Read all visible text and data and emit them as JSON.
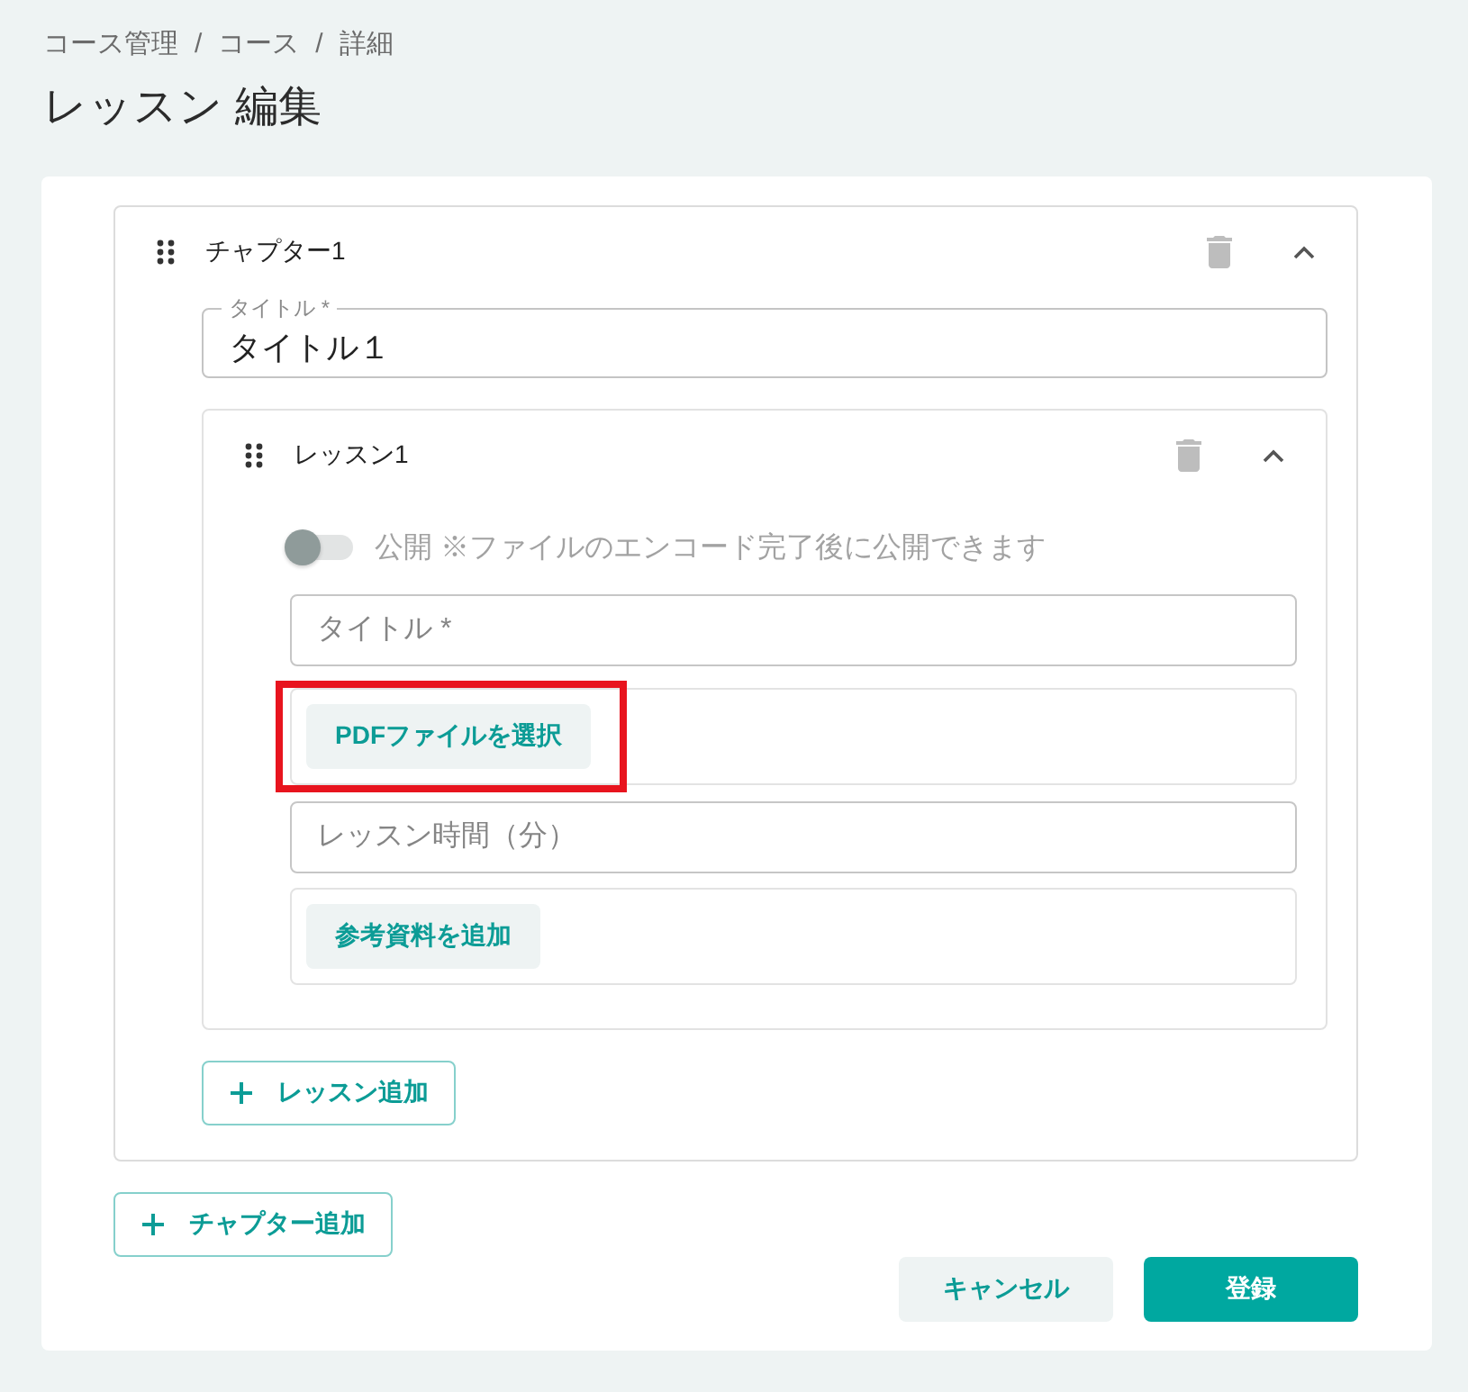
{
  "breadcrumb": [
    {
      "kind": "link",
      "label": "コース管理"
    },
    {
      "kind": "separator",
      "label": "/"
    },
    {
      "kind": "link",
      "label": "コース"
    },
    {
      "kind": "separator",
      "label": "/"
    },
    {
      "kind": "current",
      "label": "詳細"
    }
  ],
  "page_title": "レッスン 編集",
  "chapters": [
    {
      "label": "チャプター1",
      "expanded": true,
      "title_field": {
        "label": "タイトル *",
        "value": "タイトル１"
      },
      "lessons": [
        {
          "label": "レッスン1",
          "expanded": true,
          "publish_toggle": {
            "on": false,
            "disabled": true,
            "label": "公開 ※ファイルのエンコード完了後に公開できます"
          },
          "title_field": {
            "placeholder": "タイトル *"
          },
          "pdf_picker": {
            "button": "PDFファイルを選択",
            "highlighted": true
          },
          "duration_field": {
            "placeholder": "レッスン時間（分）"
          },
          "attachments": {
            "button": "参考資料を追加"
          }
        }
      ],
      "add_lesson_button": "レッスン追加"
    }
  ],
  "add_chapter_button": "チャプター追加",
  "actions": [
    {
      "kind": "secondary",
      "label": "キャンセル"
    },
    {
      "kind": "primary",
      "label": "登録"
    }
  ]
}
